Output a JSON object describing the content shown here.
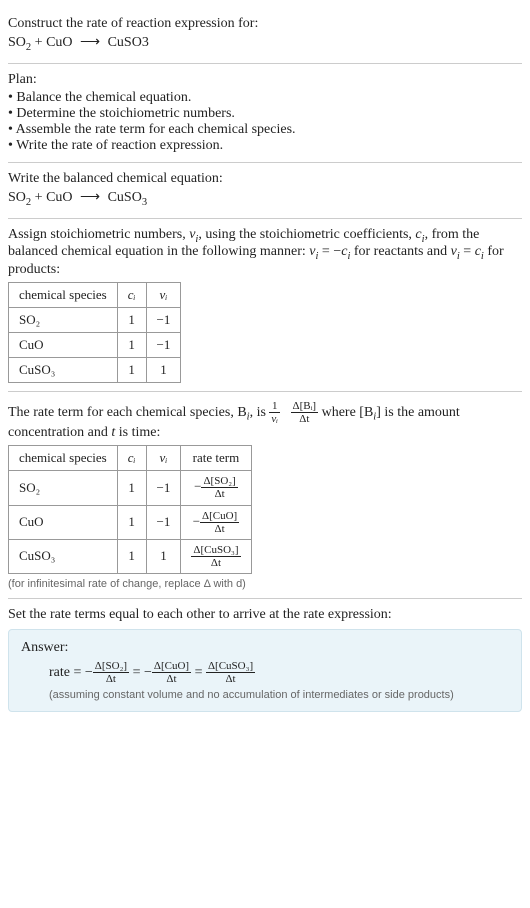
{
  "sec1": {
    "title": "Construct the rate of reaction expression for:",
    "eq_lhs_a": "SO",
    "eq_lhs_a_sub": "2",
    "plus": " + ",
    "eq_lhs_b": "CuO",
    "arrow": "⟶",
    "eq_rhs": "CuSO3"
  },
  "plan": {
    "heading": "Plan:",
    "items": [
      "Balance the chemical equation.",
      "Determine the stoichiometric numbers.",
      "Assemble the rate term for each chemical species.",
      "Write the rate of reaction expression."
    ]
  },
  "sec_balanced": {
    "title": "Write the balanced chemical equation:",
    "so": "SO",
    "so_sub": "2",
    "plus": " + ",
    "cuo": "CuO",
    "arrow": "⟶",
    "cuso": "CuSO",
    "cuso_sub": "3"
  },
  "sec_stoich": {
    "text_a": "Assign stoichiometric numbers, ",
    "nu": "ν",
    "sub_i": "i",
    "text_b": ", using the stoichiometric coefficients, ",
    "c": "c",
    "text_c": ", from the balanced chemical equation in the following manner: ",
    "rel1_l": "ν",
    "rel1_eq": " = −",
    "rel1_r": "c",
    "text_d": " for reactants and ",
    "rel2_eq": " = ",
    "text_e": " for products:",
    "headers": [
      "chemical species",
      "cᵢ",
      "νᵢ"
    ],
    "rows": [
      {
        "sp": "SO₂",
        "c": "1",
        "nu": "−1"
      },
      {
        "sp": "CuO",
        "c": "1",
        "nu": "−1"
      },
      {
        "sp": "CuSO₃",
        "c": "1",
        "nu": "1"
      }
    ]
  },
  "sec_rateterm": {
    "text_a": "The rate term for each chemical species, B",
    "sub_i": "i",
    "text_b": ", is ",
    "frac1_num": "1",
    "frac1_den": "νᵢ",
    "frac2_num": "Δ[Bᵢ]",
    "frac2_den": "Δt",
    "text_c": " where [B",
    "text_d": "] is the amount concentration and ",
    "t": "t",
    "text_e": " is time:",
    "headers": [
      "chemical species",
      "cᵢ",
      "νᵢ",
      "rate term"
    ],
    "rows": [
      {
        "sp": "SO₂",
        "c": "1",
        "nu": "−1",
        "rt_sign": "−",
        "rt_num": "Δ[SO₂]",
        "rt_den": "Δt"
      },
      {
        "sp": "CuO",
        "c": "1",
        "nu": "−1",
        "rt_sign": "−",
        "rt_num": "Δ[CuO]",
        "rt_den": "Δt"
      },
      {
        "sp": "CuSO₃",
        "c": "1",
        "nu": "1",
        "rt_sign": "",
        "rt_num": "Δ[CuSO₃]",
        "rt_den": "Δt"
      }
    ],
    "note": "(for infinitesimal rate of change, replace Δ with d)"
  },
  "sec_final": {
    "title": "Set the rate terms equal to each other to arrive at the rate expression:",
    "answer_label": "Answer:",
    "rate_word": "rate = −",
    "t1_num": "Δ[SO₂]",
    "t1_den": "Δt",
    "eq": " = −",
    "t2_num": "Δ[CuO]",
    "t2_den": "Δt",
    "eq2": " = ",
    "t3_num": "Δ[CuSO₃]",
    "t3_den": "Δt",
    "assume": "(assuming constant volume and no accumulation of intermediates or side products)"
  }
}
